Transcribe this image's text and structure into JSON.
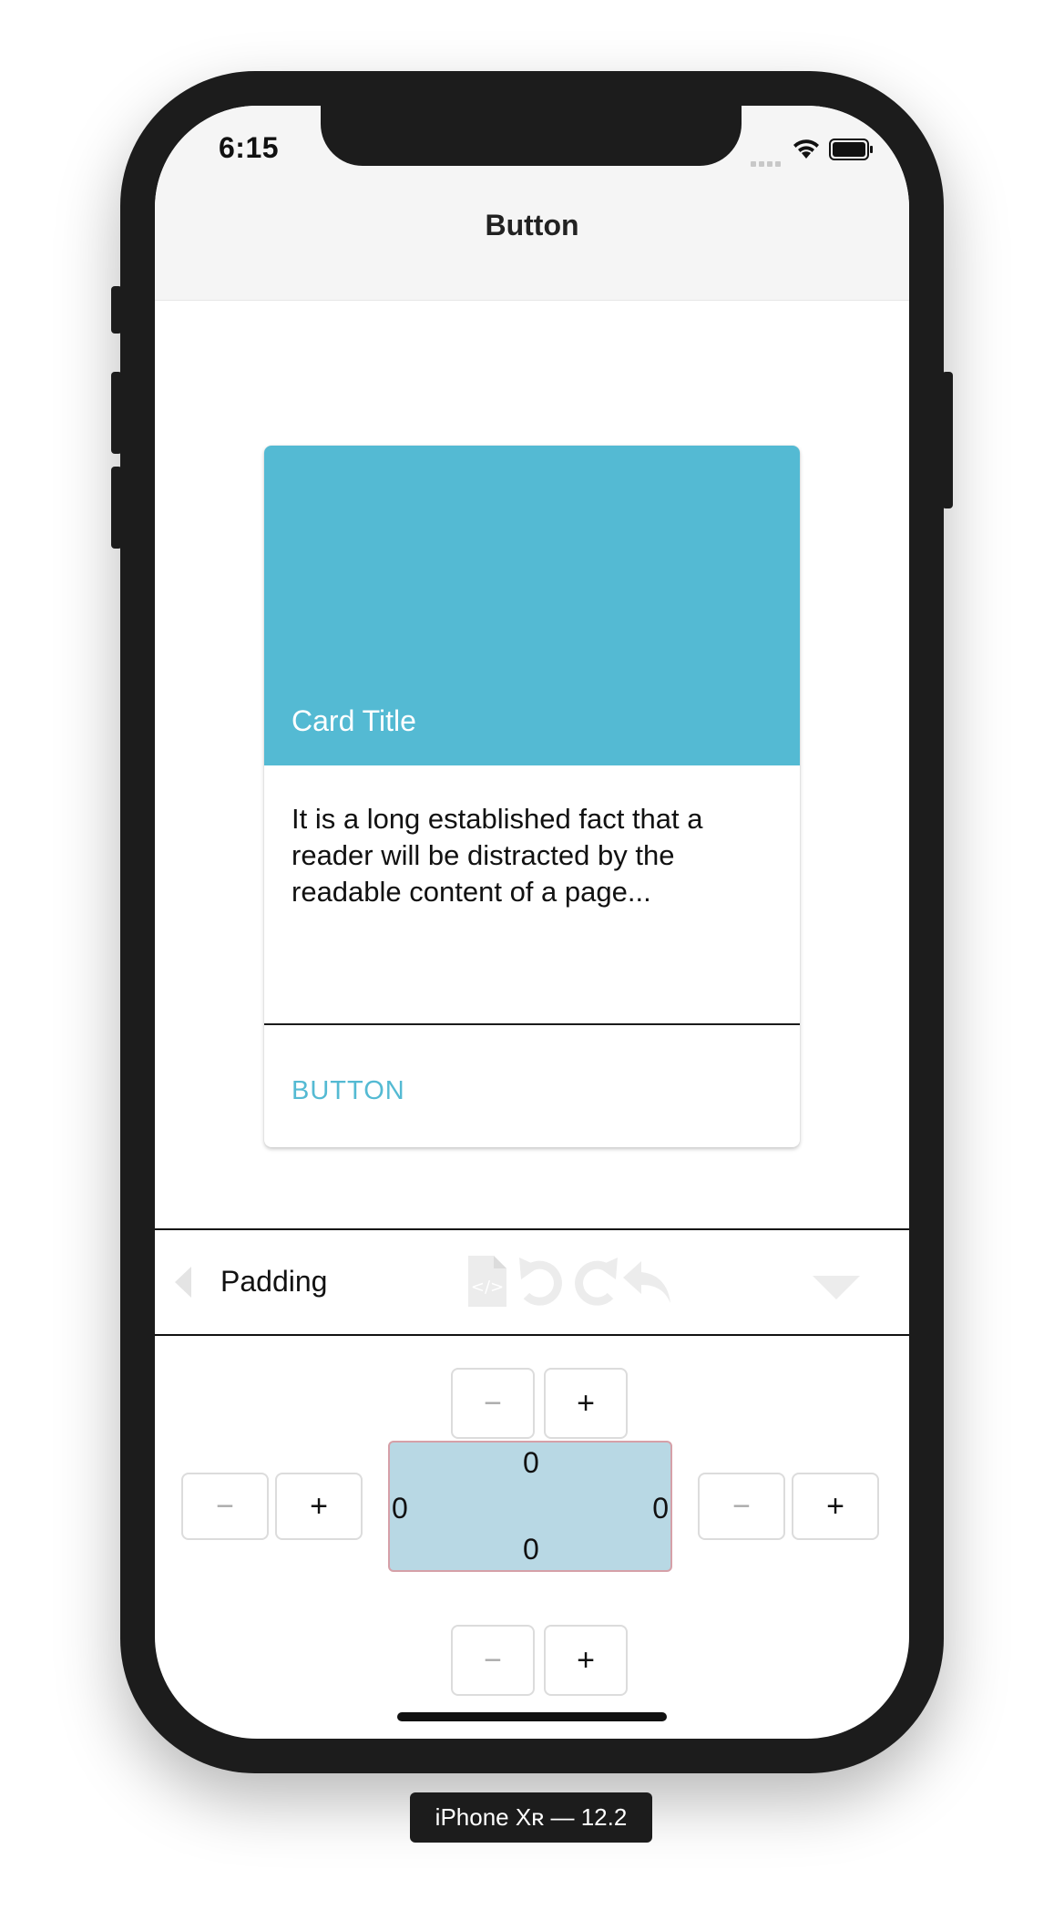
{
  "status_bar": {
    "time": "6:15"
  },
  "nav": {
    "title": "Button"
  },
  "card": {
    "title": "Card Title",
    "body": "It is a long established fact that a reader will be distracted by the readable content of a page...",
    "button_label": "BUTTON",
    "accent_color": "#54bad3"
  },
  "toolbar": {
    "label": "Padding",
    "icons": [
      "chevron-left-icon",
      "code-file-icon",
      "undo-icon",
      "redo-icon",
      "reply-icon",
      "dropdown-icon"
    ]
  },
  "padding_editor": {
    "top": "0",
    "left": "0",
    "right": "0",
    "bottom": "0",
    "minus_label": "−",
    "plus_label": "+",
    "box_color": "#b8d8e4"
  },
  "device": {
    "label": "iPhone Xʀ — 12.2"
  }
}
